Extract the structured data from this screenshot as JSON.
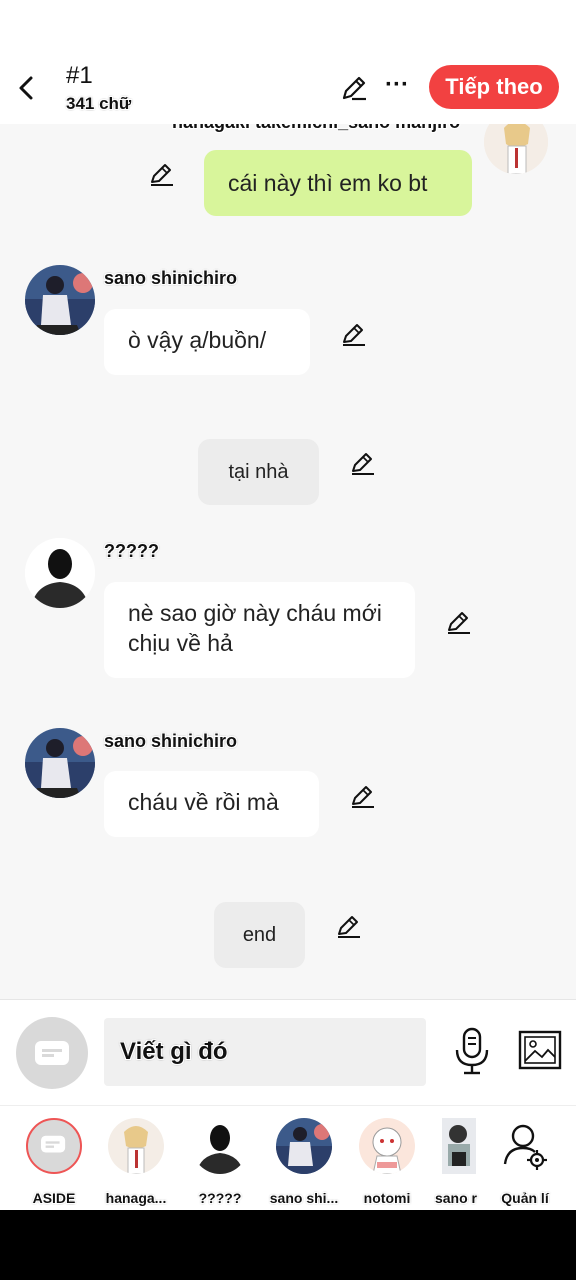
{
  "header": {
    "title": "#1",
    "word_count": "341 chữ",
    "next_label": "Tiếp theo",
    "more_label": "···"
  },
  "chat": {
    "cut_sender": "hanagaki takemichi_sano manjiro",
    "messages": [
      {
        "type": "user",
        "text": "cái này thì em ko bt"
      },
      {
        "type": "char",
        "sender": "sano shinichiro",
        "text": "ò vậy ạ/buồn/"
      },
      {
        "type": "narration",
        "text": "tại nhà"
      },
      {
        "type": "char",
        "sender": "?????",
        "text": "nè sao giờ này cháu mới chịu về hả"
      },
      {
        "type": "char",
        "sender": "sano shinichiro",
        "text": "cháu về rồi mà"
      },
      {
        "type": "narration",
        "text": "end"
      }
    ]
  },
  "input": {
    "placeholder": "Viết gì đó"
  },
  "tray": {
    "items": [
      {
        "label": "ASIDE"
      },
      {
        "label": "hanaga..."
      },
      {
        "label": "?????"
      },
      {
        "label": "sano shi..."
      },
      {
        "label": "notomi"
      },
      {
        "label": "sano r"
      },
      {
        "label": "Quản lí"
      }
    ]
  },
  "colors": {
    "accent": "#f24141",
    "user_bubble": "#d8f59b",
    "narration_bubble": "#ececec"
  }
}
